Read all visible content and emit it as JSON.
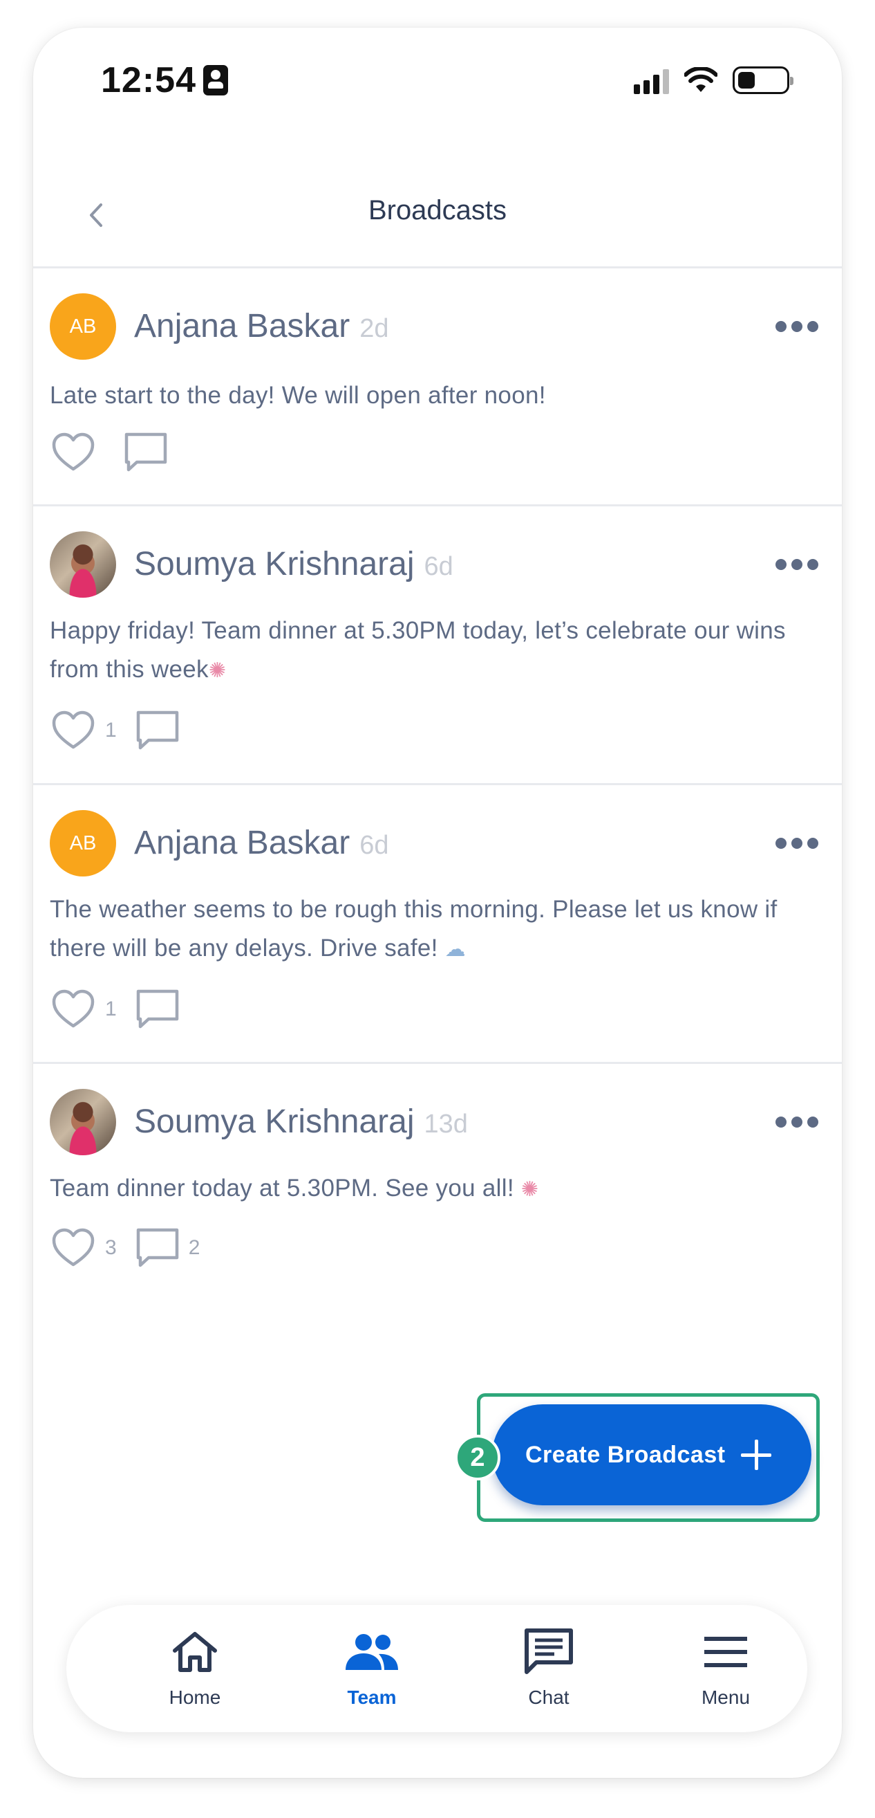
{
  "status_bar": {
    "time": "12:54"
  },
  "header": {
    "title": "Broadcasts"
  },
  "posts": [
    {
      "author": "Anjana Baskar",
      "initials": "AB",
      "age": "2d",
      "message": "Late start to the day! We will open after noon!",
      "likes": "",
      "comments": ""
    },
    {
      "author": "Soumya Krishnaraj",
      "initials": "",
      "age": "6d",
      "message": "Happy friday! Team dinner at 5.30PM today, let’s celebrate our wins from this week",
      "likes": "1",
      "comments": ""
    },
    {
      "author": "Anjana Baskar",
      "initials": "AB",
      "age": "6d",
      "message": "The weather seems to be rough this morning. Please let us know if there will be any delays. Drive safe!",
      "likes": "1",
      "comments": ""
    },
    {
      "author": "Soumya Krishnaraj",
      "initials": "",
      "age": "13d",
      "message": "Team dinner today at 5.30PM. See you all!",
      "likes": "3",
      "comments": "2"
    }
  ],
  "fab": {
    "label": "Create Broadcast",
    "step": "2"
  },
  "nav": {
    "items": [
      {
        "label": "Home",
        "icon": "home-icon"
      },
      {
        "label": "Team",
        "icon": "team-icon",
        "active": true
      },
      {
        "label": "Chat",
        "icon": "chat-icon"
      },
      {
        "label": "Menu",
        "icon": "menu-icon"
      }
    ]
  },
  "colors": {
    "accent": "#0a64d6",
    "avatar": "#f9a51b",
    "highlight": "#2ea77a",
    "text": "#5d6a84"
  }
}
